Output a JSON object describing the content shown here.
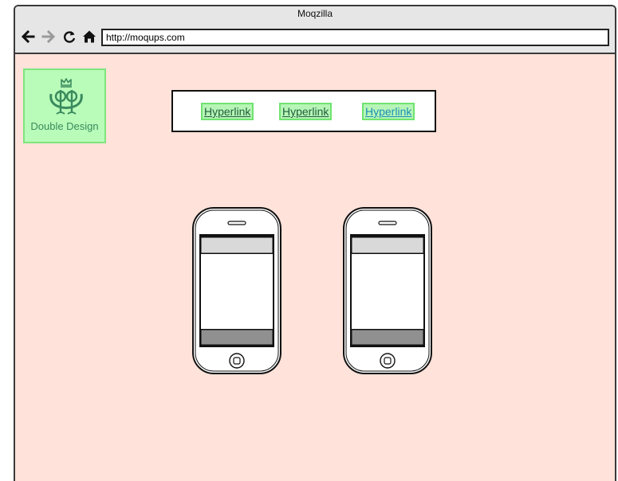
{
  "window": {
    "title": "Moqzilla"
  },
  "toolbar": {
    "back_icon": "arrow-left-icon",
    "forward_icon": "arrow-right-icon",
    "reload_icon": "reload-icon",
    "home_icon": "home-icon",
    "url": "http://moqups.com"
  },
  "logo": {
    "icon": "crowned-monogram-icon",
    "text": "Double Design"
  },
  "nav": {
    "links": [
      {
        "label": "Hyperlink",
        "color": "#1f5f3a"
      },
      {
        "label": "Hyperlink",
        "color": "#1f5f3a"
      },
      {
        "label": "Hyperlink",
        "color": "#1a8fb5"
      }
    ]
  },
  "colors": {
    "page_background": "#ffe2d9",
    "logo_background": "#b9fbb9",
    "highlight_border": "#6fe36f"
  },
  "phones": [
    {
      "label": ""
    },
    {
      "label": ""
    }
  ]
}
